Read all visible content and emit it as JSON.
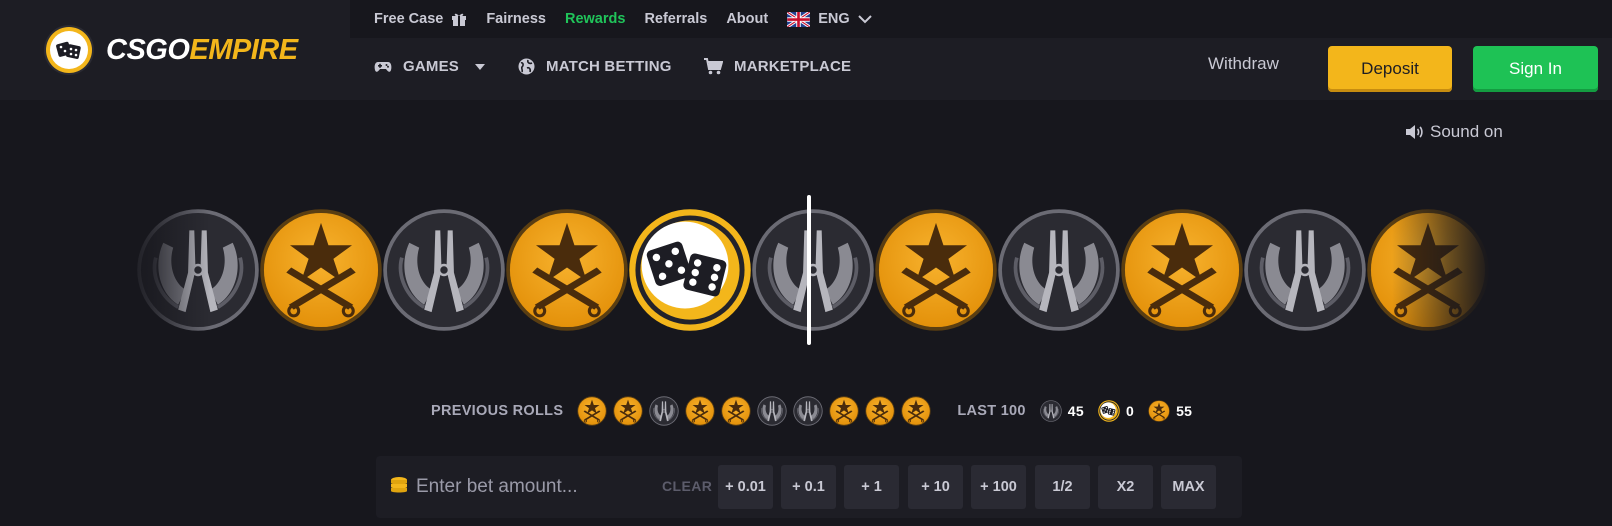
{
  "brand": {
    "logo_white": "CSGO",
    "logo_yellow": "EMPIRE"
  },
  "topbar": {
    "free_case": "Free Case",
    "fairness": "Fairness",
    "rewards": "Rewards",
    "referrals": "Referrals",
    "about": "About",
    "language": "ENG"
  },
  "nav": {
    "games": "GAMES",
    "match_betting": "MATCH BETTING",
    "marketplace": "MARKETPLACE",
    "withdraw": "Withdraw",
    "deposit": "Deposit",
    "sign_in": "Sign In"
  },
  "sound": {
    "label": "Sound on"
  },
  "roulette": {
    "strip": [
      "ct",
      "t",
      "ct",
      "t",
      "bonus",
      "ct",
      "t",
      "ct",
      "t",
      "ct",
      "t"
    ],
    "colors": {
      "t": "#f3a10d",
      "ct": "#3a3a44",
      "bonus": "#f3b61b"
    }
  },
  "previous_rolls": {
    "label": "PREVIOUS ROLLS",
    "rolls": [
      "t",
      "t",
      "ct",
      "t",
      "t",
      "ct",
      "ct",
      "t",
      "t",
      "t"
    ]
  },
  "last100": {
    "label": "LAST 100",
    "ct": "45",
    "bonus": "0",
    "t": "55"
  },
  "bet": {
    "placeholder": "Enter bet amount...",
    "clear": "CLEAR",
    "quick_buttons": [
      "+ 0.01",
      "+ 0.1",
      "+ 1",
      "+ 10",
      "+ 100",
      "1/2",
      "X2",
      "MAX"
    ]
  }
}
